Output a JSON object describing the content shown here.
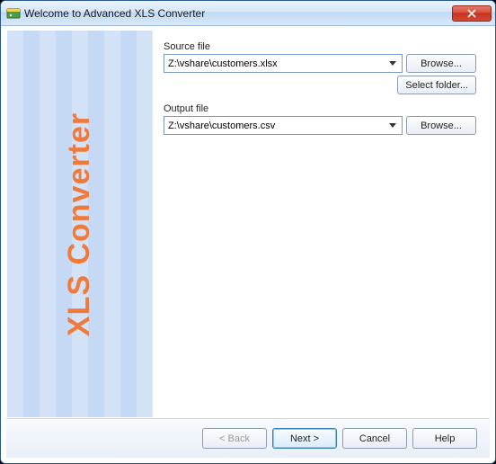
{
  "window": {
    "title": "Welcome to Advanced XLS Converter"
  },
  "sidebar": {
    "brand": "XLS Converter"
  },
  "source": {
    "label": "Source file",
    "value": "Z:\\vshare\\customers.xlsx",
    "browse": "Browse...",
    "select_folder": "Select folder..."
  },
  "output": {
    "label": "Output file",
    "value": "Z:\\vshare\\customers.csv",
    "browse": "Browse..."
  },
  "footer": {
    "back": "< Back",
    "next": "Next >",
    "cancel": "Cancel",
    "help": "Help"
  }
}
